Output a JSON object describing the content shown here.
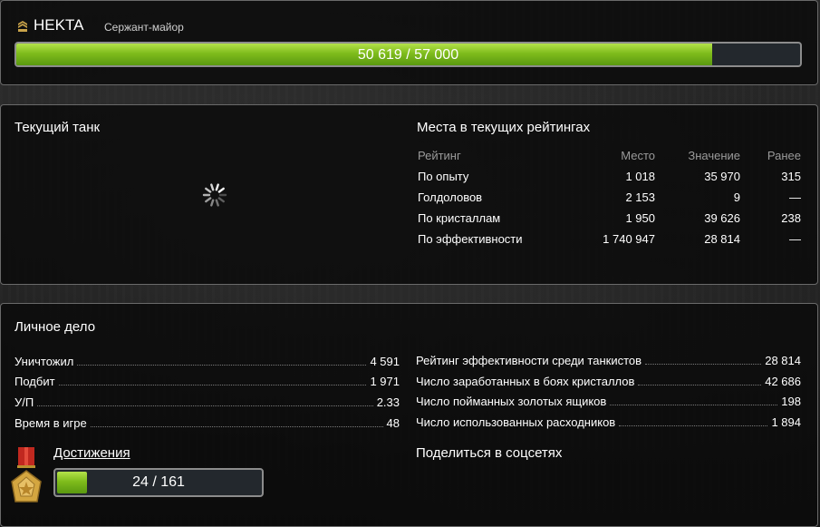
{
  "profile": {
    "nickname": "HEKTA",
    "rank": "Сержант-майор",
    "xp_text": "50 619 / 57 000",
    "xp_progress": 0.8881
  },
  "current_tank": {
    "title": "Текущий танк",
    "state": "loading"
  },
  "ratings": {
    "title": "Места в текущих рейтингах",
    "columns": [
      "Рейтинг",
      "Место",
      "Значение",
      "Ранее"
    ],
    "rows": [
      {
        "name": "По опыту",
        "place": "1 018",
        "value": "35 970",
        "before": "315"
      },
      {
        "name": "Голдоловов",
        "place": "2 153",
        "value": "9",
        "before": "—"
      },
      {
        "name": "По кристаллам",
        "place": "1 950",
        "value": "39 626",
        "before": "238"
      },
      {
        "name": "По эффективности",
        "place": "1 740 947",
        "value": "28 814",
        "before": "—"
      }
    ]
  },
  "personal": {
    "title": "Личное дело",
    "left_stats": [
      {
        "label": "Уничтожил",
        "value": "4 591"
      },
      {
        "label": "Подбит",
        "value": "1 971"
      },
      {
        "label": "У/П",
        "value": "2.33"
      },
      {
        "label": "Время в игре",
        "value": "48"
      }
    ],
    "right_stats": [
      {
        "label": "Рейтинг эффективности среди танкистов",
        "value": "28 814"
      },
      {
        "label": "Число заработанных в боях кристаллов",
        "value": "42 686"
      },
      {
        "label": "Число пойманных золотых ящиков",
        "value": "198"
      },
      {
        "label": "Число использованных расходников",
        "value": "1 894"
      }
    ]
  },
  "achievements": {
    "link_label": "Достижения",
    "progress_text": "24 / 161",
    "progress": 0.149
  },
  "share": {
    "title": "Поделиться в соцсетях"
  },
  "icons": {
    "rank": "rank-chevron-icon",
    "spinner": "loading-spinner-icon",
    "medal": "medal-icon"
  },
  "colors": {
    "accent_green": "#7fbc1c",
    "panel_border": "#6a6a6a"
  }
}
